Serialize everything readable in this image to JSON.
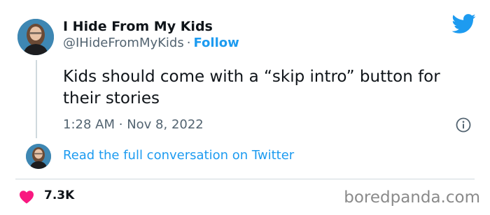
{
  "author": {
    "display_name": "I Hide From My Kids",
    "handle": "@IHideFromMyKids",
    "separator": "·",
    "follow_label": "Follow"
  },
  "tweet": {
    "text": "Kids should come with a “skip intro” button for their stories",
    "time": "1:28 AM",
    "separator": "·",
    "date": "Nov 8, 2022"
  },
  "conversation": {
    "link_text": "Read the full conversation on Twitter"
  },
  "engagement": {
    "likes": "7.3K"
  },
  "watermark": {
    "text": "boredpanda.com"
  },
  "icons": {
    "brand": "twitter-bird-icon",
    "info": "info-icon",
    "like": "heart-icon"
  },
  "colors": {
    "accent": "#1d9bf0",
    "secondary_text": "#536471",
    "like": "#f91880",
    "divider": "#cfd9de"
  }
}
